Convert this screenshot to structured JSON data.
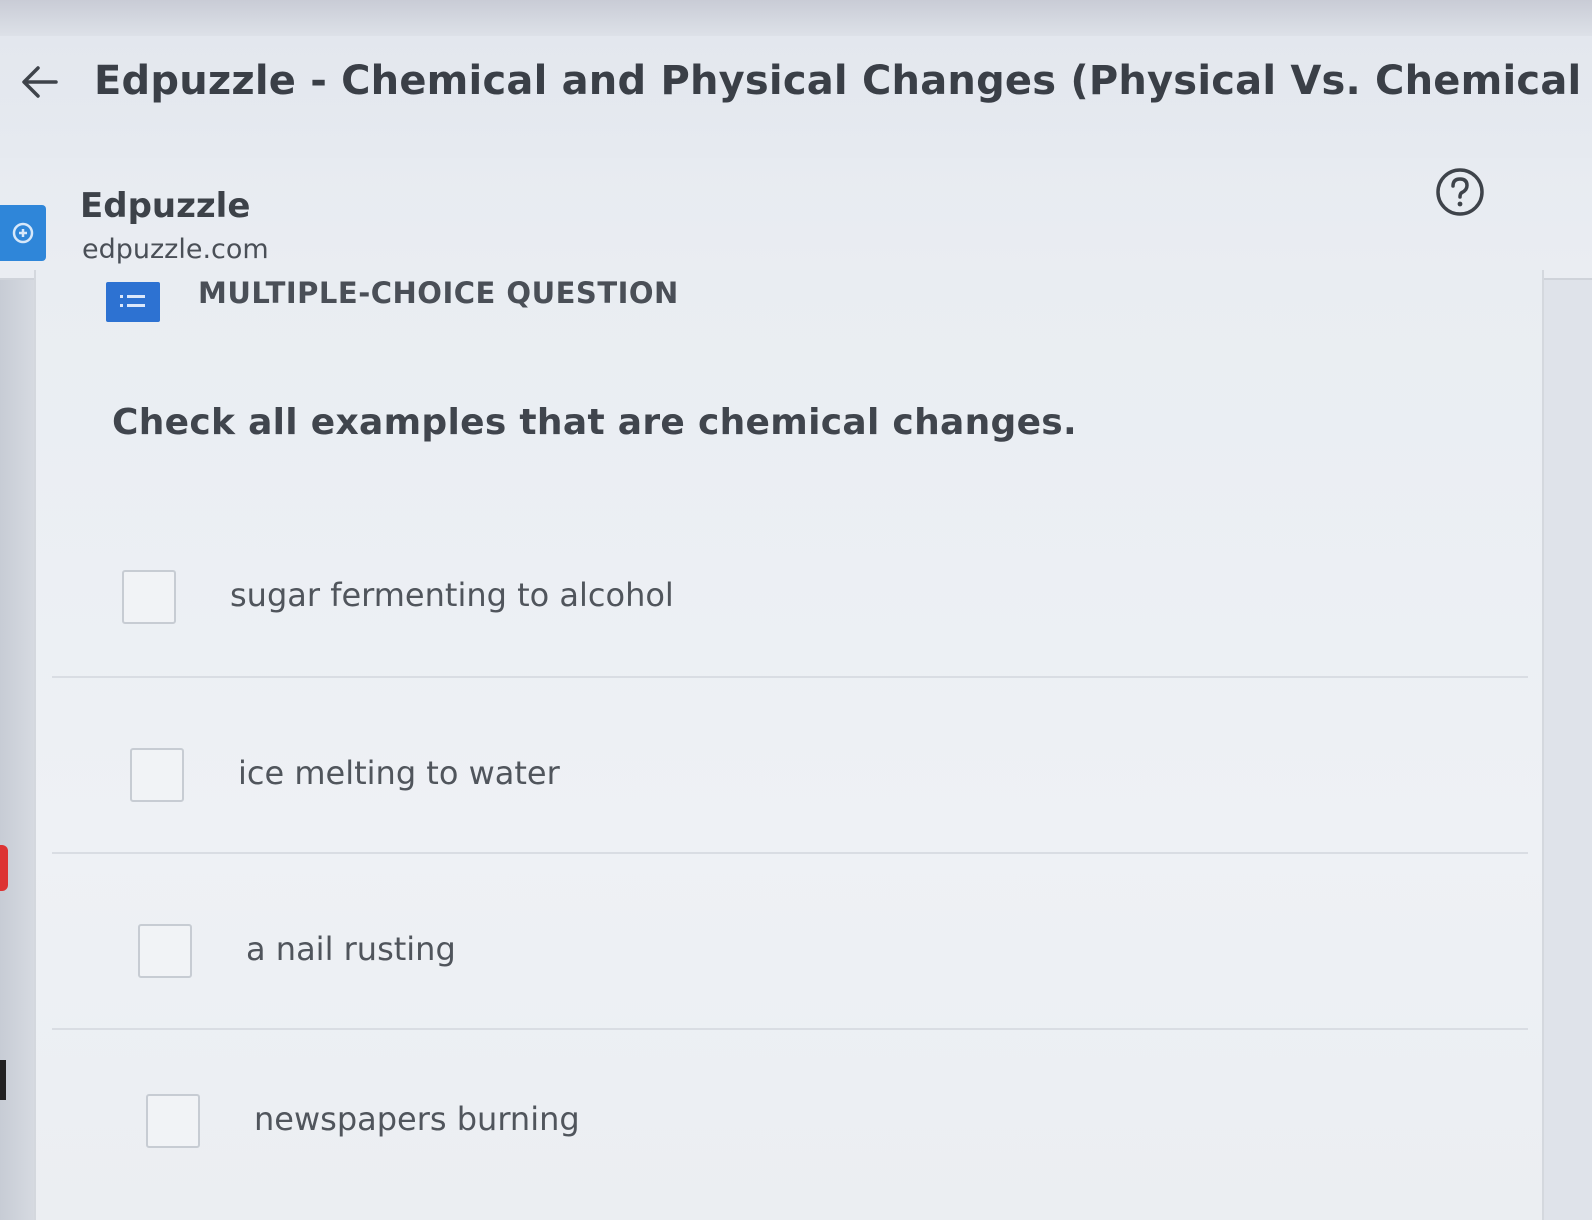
{
  "window": {
    "title": "Edpuzzle - Chemical and Physical Changes (Physical Vs. Chemical Changes - Ex"
  },
  "site": {
    "name": "Edpuzzle",
    "url": "edpuzzle.com"
  },
  "question": {
    "type_label": "MULTIPLE-CHOICE QUESTION",
    "prompt": "Check all examples that are chemical changes.",
    "options": [
      {
        "label": "sugar fermenting to alcohol",
        "checked": false
      },
      {
        "label": "ice melting to water",
        "checked": false
      },
      {
        "label": "a nail rusting",
        "checked": false
      },
      {
        "label": "newspapers burning",
        "checked": false
      }
    ]
  },
  "icons": {
    "back": "arrow-left-icon",
    "help": "question-circle-icon",
    "logo": "edpuzzle-logo-icon",
    "question_type": "list-icon"
  },
  "colors": {
    "accent": "#2d72d2",
    "logo_blue": "#2f86d9",
    "text_dark": "#3a3f47"
  }
}
